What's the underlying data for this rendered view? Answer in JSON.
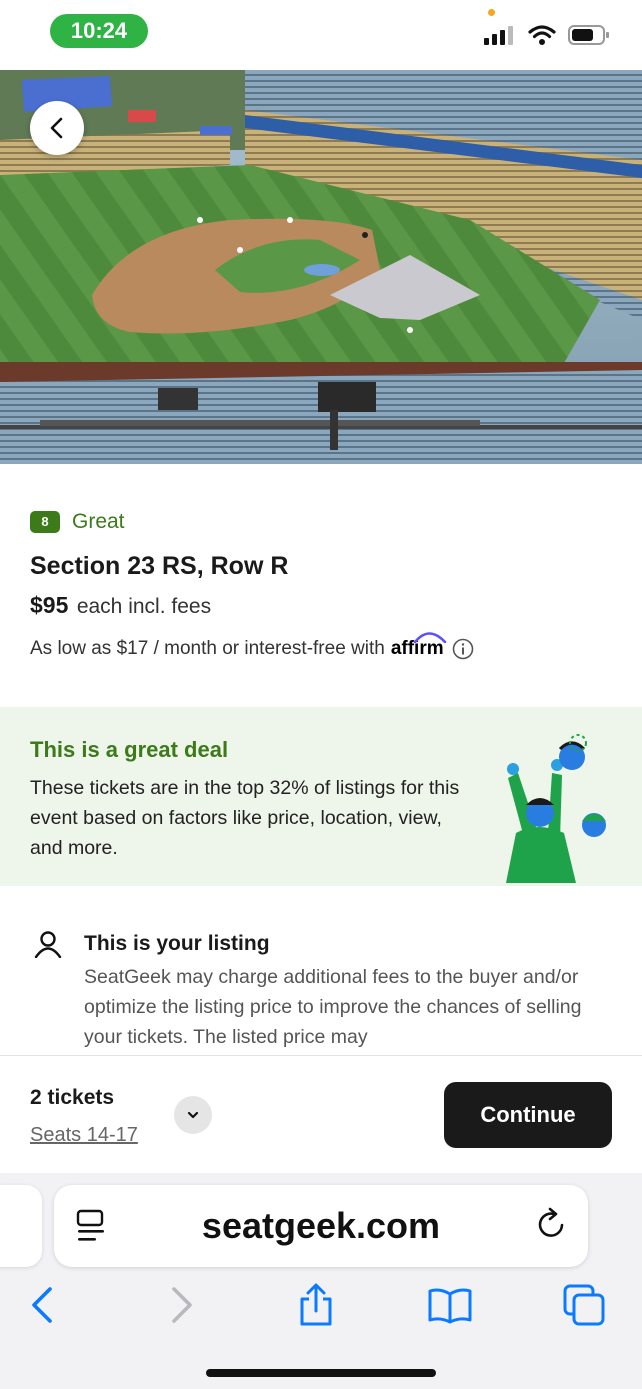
{
  "status_bar": {
    "time": "10:24"
  },
  "listing": {
    "rating_score": "8",
    "rating_label": "Great",
    "section_row": "Section 23 RS, Row R",
    "price": "$95",
    "price_suffix": "each incl. fees",
    "financing_text": "As low as $17 / month or interest-free with",
    "financing_brand": "affirm"
  },
  "deal": {
    "title": "This is a great deal",
    "body": "These tickets are in the top 32% of listings for this event based on factors like price, location, view, and more."
  },
  "your_listing": {
    "title": "This is your listing",
    "body": "SeatGeek may charge additional fees to the buyer and/or optimize the listing price to improve the chances of selling your tickets. The listed price may"
  },
  "action_bar": {
    "tickets_count": "2 tickets",
    "seats_link": "Seats 14-17",
    "continue_label": "Continue"
  },
  "browser": {
    "url": "seatgeek.com"
  },
  "colors": {
    "status_pill": "#2fb344",
    "brand_green": "#3c7a1a",
    "deal_bg": "#eef5ea",
    "continue_bg": "#1a1a1a",
    "safari_blue": "#0a7aff"
  },
  "icons": [
    "back-chevron-icon",
    "info-icon",
    "person-icon",
    "chevron-down-icon",
    "reader-icon",
    "reload-icon",
    "back-icon",
    "forward-icon",
    "share-icon",
    "bookmarks-icon",
    "tabs-icon"
  ]
}
